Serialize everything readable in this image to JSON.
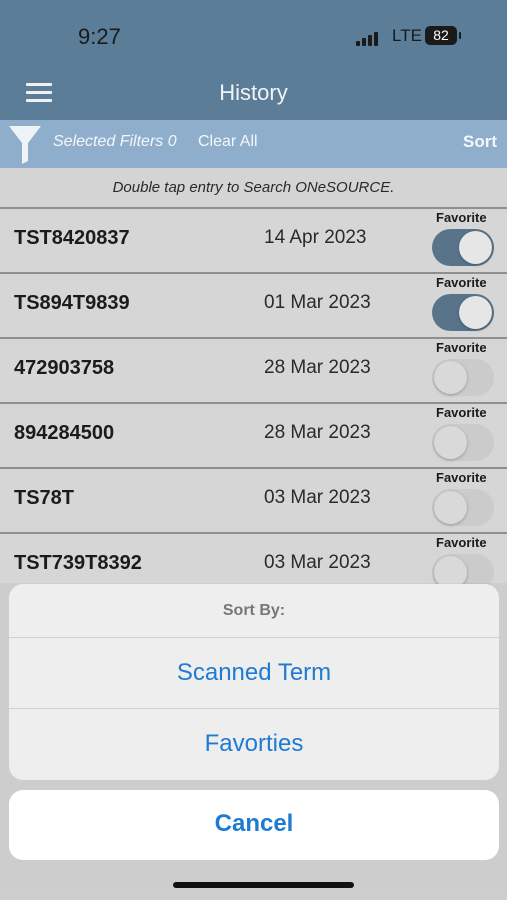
{
  "status": {
    "time": "9:27",
    "network": "LTE",
    "battery": "82"
  },
  "nav": {
    "title": "History",
    "menu_icon": "hamburger-menu-icon"
  },
  "filter_bar": {
    "filter_icon": "funnel-icon",
    "selected_filters": "Selected Filters 0",
    "clear_all": "Clear All",
    "sort": "Sort"
  },
  "hint": "Double tap entry to Search ONeSOURCE.",
  "entries": [
    {
      "term": "TST8420837",
      "date": "14 Apr 2023",
      "favorite_label": "Favorite",
      "favorite": true
    },
    {
      "term": "TS894T9839",
      "date": "01 Mar 2023",
      "favorite_label": "Favorite",
      "favorite": true
    },
    {
      "term": "472903758",
      "date": "28 Mar 2023",
      "favorite_label": "Favorite",
      "favorite": false
    },
    {
      "term": "894284500",
      "date": "28 Mar 2023",
      "favorite_label": "Favorite",
      "favorite": false
    },
    {
      "term": "TS78T",
      "date": "03 Mar 2023",
      "favorite_label": "Favorite",
      "favorite": false
    },
    {
      "term": "TST739T8392",
      "date": "03 Mar 2023",
      "favorite_label": "Favorite",
      "favorite": false
    }
  ],
  "sort_sheet": {
    "title": "Sort By:",
    "options": [
      "Scanned Term",
      "Favorties"
    ],
    "cancel": "Cancel"
  },
  "colors": {
    "header": "#5b7d97",
    "filter_bar": "#8eaecc",
    "toggle_on": "#59748a",
    "action_blue": "#1e7bd4"
  }
}
